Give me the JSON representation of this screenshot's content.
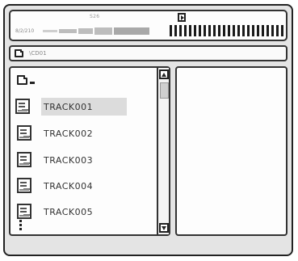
{
  "status": {
    "counter": "S26",
    "date": "8/2/210",
    "play_icon": "play-icon"
  },
  "path": {
    "icon": "folder-icon",
    "text": "\\CD01"
  },
  "browser": {
    "parent_icon": "folder-up-icon",
    "tracks": [
      {
        "label": "TRACK001",
        "selected": true
      },
      {
        "label": "TRACK002",
        "selected": false
      },
      {
        "label": "TRACK003",
        "selected": false
      },
      {
        "label": "TRACK004",
        "selected": false
      },
      {
        "label": "TRACK005",
        "selected": false
      }
    ],
    "more_indicator": "more-items-icon"
  },
  "colors": {
    "frame": "#222222",
    "panel": "#fdfdfd",
    "device": "#e4e4e4",
    "selection": "#dcdcdc"
  }
}
